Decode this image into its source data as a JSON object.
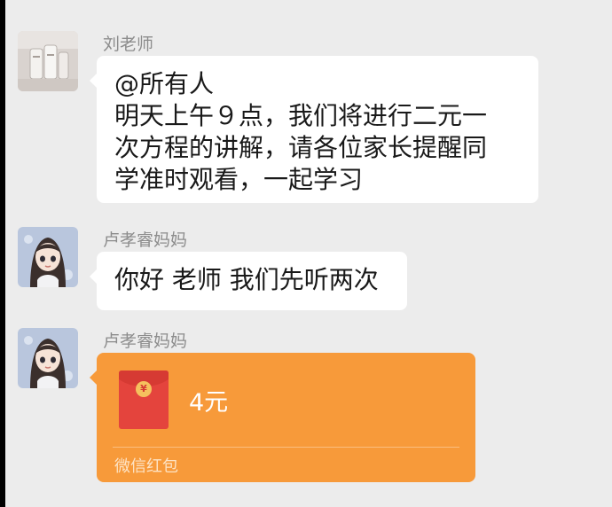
{
  "messages": [
    {
      "sender": "刘老师",
      "avatar_icon": "photo-avatar-icon",
      "type": "text",
      "lines": [
        "@所有人",
        "明天上午９点，我们将进行二元一",
        "次方程的讲解，请各位家长提醒同",
        "学准时观看，一起学习"
      ]
    },
    {
      "sender": "卢孝睿妈妈",
      "avatar_icon": "cartoon-girl-avatar-icon",
      "type": "text",
      "lines": [
        "你好  老师 我们先听两次"
      ]
    },
    {
      "sender": "卢孝睿妈妈",
      "avatar_icon": "cartoon-girl-avatar-icon",
      "type": "red_packet",
      "amount": "4元",
      "label": "微信红包"
    }
  ],
  "colors": {
    "background": "#ececec",
    "bubble": "#ffffff",
    "red_packet": "#f79a3a",
    "envelope": "#e4443d"
  }
}
